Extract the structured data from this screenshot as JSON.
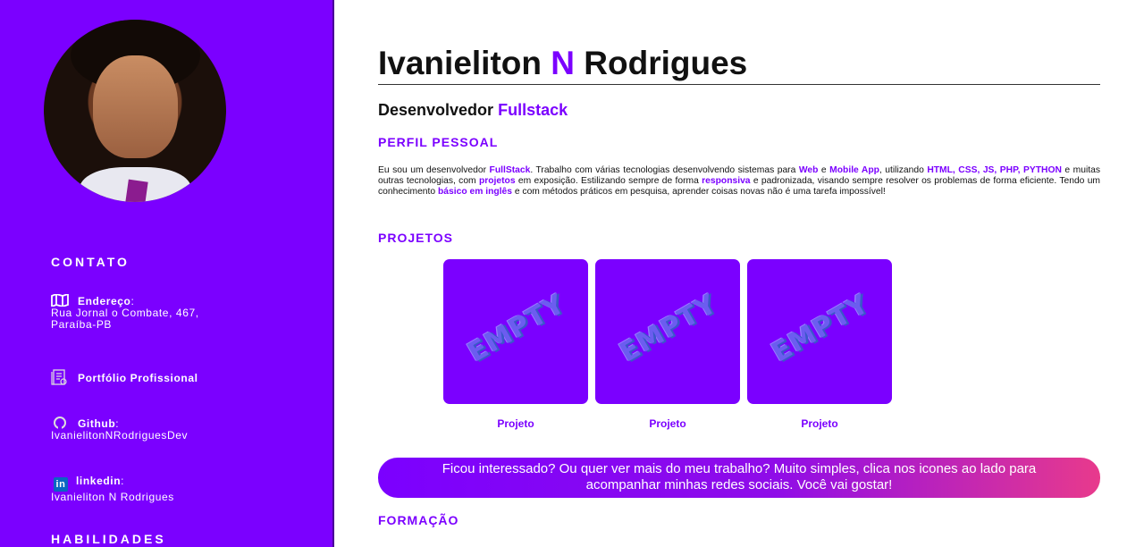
{
  "sidebar": {
    "contact_heading": "CONTATO",
    "address_label": "Endereço",
    "address_value_1": "Rua Jornal o Combate, 467,",
    "address_value_2": "Paraíba-PB",
    "portfolio_label": "Portfólio Profissional",
    "github_label": "Github",
    "github_value": "IvanielitonNRodriguesDev",
    "linkedin_badge": "in",
    "linkedin_label": "linkedin",
    "linkedin_value": "Ivanieliton N Rodrigues",
    "skills_heading": "HABILIDADES"
  },
  "header": {
    "name_first": "Ivanieliton",
    "name_middle": "N",
    "name_last": "Rodrigues",
    "role_prefix": "Desenvolvedor",
    "role_accent": "Fullstack"
  },
  "profile": {
    "heading": "PERFIL PESSOAL",
    "t1": "Eu sou um desenvolvedor ",
    "b1": "FullStack",
    "t2": ". Trabalho com várias tecnologias desenvolvendo sistemas para ",
    "b2": "Web",
    "t3": " e ",
    "b3": "Mobile App",
    "t4": ", utilizando ",
    "b4": "HTML, CSS, JS, PHP, PYTHON",
    "t5": " e muitas outras tecnologias, com ",
    "b5": "projetos",
    "t6": " em exposição. Estilizando sempre de forma ",
    "b6": "responsiva",
    "t7": " e padronizada, visando sempre resolver os problemas de forma eficiente. Tendo um conhecimento ",
    "b7": "básico em inglês",
    "t8": " e com métodos práticos em pesquisa, aprender coisas novas não é uma tarefa impossível!"
  },
  "projects": {
    "heading": "PROJETOS",
    "items": [
      {
        "label": "Projeto",
        "image_text": "EMPTY"
      },
      {
        "label": "Projeto",
        "image_text": "EMPTY"
      },
      {
        "label": "Projeto",
        "image_text": "EMPTY"
      }
    ]
  },
  "cta": {
    "line1": "Ficou interessado? Ou quer ver mais do meu trabalho? Muito simples, clica nos icones ao lado para",
    "line2": "acompanhar minhas redes sociais. Você vai gostar!"
  },
  "education": {
    "heading": "FORMAÇÃO"
  },
  "colors": {
    "accent": "#7b00ff",
    "cta_end": "#e83a8c",
    "linkedin": "#0a66c2"
  },
  "icons": [
    "map-icon",
    "portfolio-icon",
    "github-icon",
    "linkedin-icon"
  ]
}
